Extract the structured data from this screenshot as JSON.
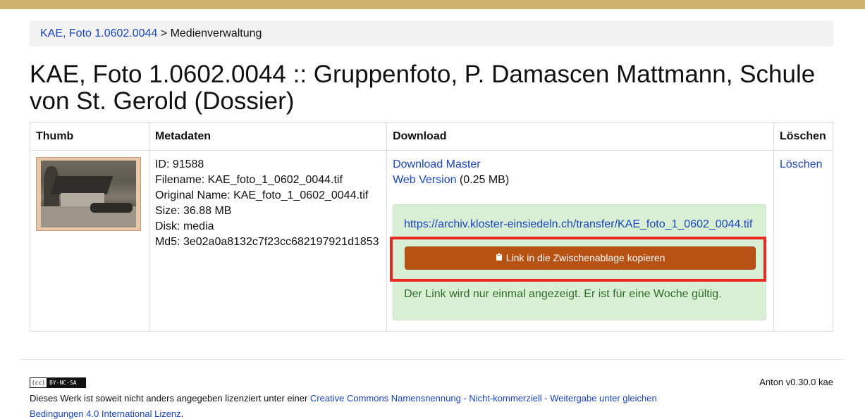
{
  "breadcrumb": {
    "link": "KAE, Foto 1.0602.0044",
    "separator": " > ",
    "current": "Medienverwaltung"
  },
  "page_title": "KAE, Foto 1.0602.0044 :: Gruppenfoto, P. Damascen Mattmann, Schule von St. Gerold (Dossier)",
  "table": {
    "headers": {
      "thumb": "Thumb",
      "meta": "Metadaten",
      "download": "Download",
      "delete": "Löschen"
    },
    "metadata": {
      "id": "ID: 91588",
      "filename": "Filename: KAE_foto_1_0602_0044.tif",
      "original": "Original Name: KAE_foto_1_0602_0044.tif",
      "size": "Size: 36.88 MB",
      "disk": "Disk: media",
      "md5": "Md5: 3e02a0a8132c7f23cc682197921d1853"
    },
    "download": {
      "master_link": "Download Master",
      "web_link": "Web Version",
      "web_size": " (0.25 MB)",
      "url": "https://archiv.kloster-einsiedeln.ch/transfer/KAE_foto_1_0602_0044.tif",
      "copy_button": "Link in die Zwischenablage kopieren",
      "copy_icon": "clipboard-icon",
      "notice": "Der Link wird nur einmal angezeigt. Er ist für eine Woche gültig."
    },
    "delete_link": "Löschen"
  },
  "footer": {
    "cc_badge_left": "(cc)",
    "cc_badge_right": "BY-NC-SA",
    "version": "Anton v0.30.0 kae",
    "license_text": "Dieses Werk ist soweit nicht anders angegeben lizenziert unter einer ",
    "license_link": "Creative Commons Namensnennung - Nicht-kommerziell - Weitergabe unter gleichen Bedingungen 4.0 International Lizenz",
    "license_end": "."
  },
  "colors": {
    "topbar": "#cdb36d",
    "button": "#b85214",
    "success_bg": "#d8efd3",
    "highlight": "#ea2a20",
    "link": "#1a44c2"
  }
}
